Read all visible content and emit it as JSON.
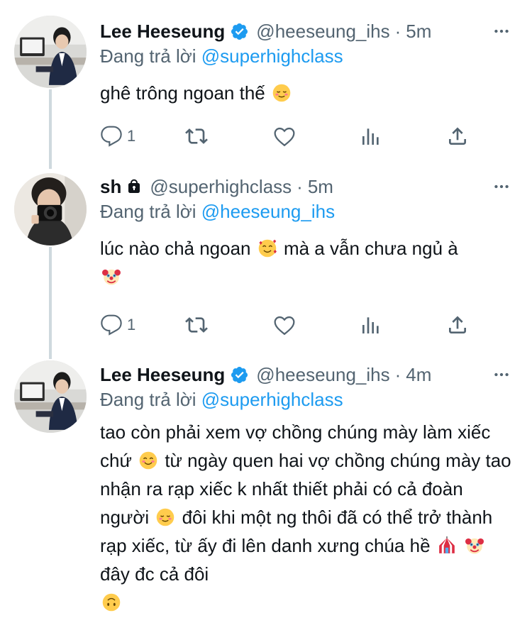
{
  "tweets": [
    {
      "name": "Lee Heeseung",
      "verified": true,
      "locked": false,
      "handle": "@heeseung_ihs",
      "time": "5m",
      "reply_prefix": "Đang trả lời ",
      "reply_to": "@superhighclass",
      "text_parts": [
        "ghê trông ngoan thế "
      ],
      "emojis": [
        "relieved-face"
      ],
      "actions": {
        "reply_count": "1"
      },
      "avatar": "lee-heeseung-avatar"
    },
    {
      "name": "sh",
      "verified": false,
      "locked": true,
      "handle": "@superhighclass",
      "time": "5m",
      "reply_prefix": "Đang trả lời ",
      "reply_to": "@heeseung_ihs",
      "text_parts": [
        "lúc nào chả ngoan ",
        " mà a vẫn chưa ngủ à"
      ],
      "emojis": [
        "smiling-face-with-hearts",
        "clown-face"
      ],
      "actions": {
        "reply_count": "1"
      },
      "avatar": "camera-selfie-avatar"
    },
    {
      "name": "Lee Heeseung",
      "verified": true,
      "locked": false,
      "handle": "@heeseung_ihs",
      "time": "4m",
      "reply_prefix": "Đang trả lời ",
      "reply_to": "@superhighclass",
      "text_parts": [
        "tao còn phải xem vợ chồng chúng mày làm xiếc chứ ",
        " từ ngày quen hai vợ chồng chúng mày tao nhận ra rạp xiếc k nhất thiết phải có cả đoàn người ",
        " đôi khi một ng thôi đã có thể trở thành rạp xiếc, từ ấy đi lên danh xưng chúa hề ",
        " ",
        " đây đc cả đôi"
      ],
      "emojis": [
        "smiling-face-with-smiling-eyes",
        "relieved-face",
        "circus-tent",
        "clown-face",
        "upside-down-face"
      ],
      "avatar": "lee-heeseung-avatar"
    }
  ],
  "colors": {
    "text": "#0f1419",
    "secondary": "#536471",
    "link": "#1d9bf0",
    "verified": "#1d9bf0",
    "thread_line": "#cfd9de"
  }
}
